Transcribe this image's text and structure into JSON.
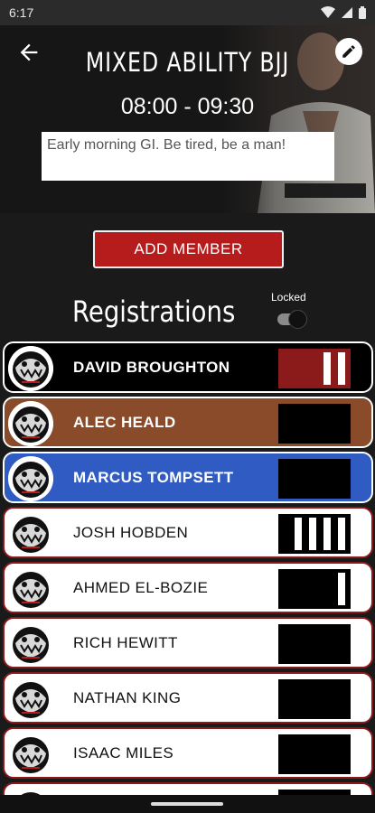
{
  "status": {
    "time": "6:17"
  },
  "header": {
    "title": "MIXED ABILITY BJJ",
    "time": "08:00 - 09:30",
    "description": "Early morning GI. Be tired, be a man!"
  },
  "actions": {
    "add_member": "ADD MEMBER"
  },
  "registrations": {
    "title": "Registrations",
    "locked_label": "Locked",
    "locked": false
  },
  "members": [
    {
      "name": "DAVID  BROUGHTON",
      "row_color": "#000000",
      "name_color": "#ffffff",
      "bold": true,
      "belt": {
        "color": "#8b1a1a",
        "stripes": 2,
        "stripe_color": "#ffffff"
      }
    },
    {
      "name": "ALEC  HEALD",
      "row_color": "#8a4b2a",
      "name_color": "#ffffff",
      "bold": true,
      "belt": {
        "color": "#000000",
        "stripes": 0,
        "stripe_color": "#ffffff"
      }
    },
    {
      "name": "MARCUS  TOMPSETT",
      "row_color": "#2f5bc2",
      "name_color": "#ffffff",
      "bold": true,
      "belt": {
        "color": "#000000",
        "stripes": 0,
        "stripe_color": "#ffffff"
      }
    },
    {
      "name": "JOSH HOBDEN",
      "row_color": "#ffffff",
      "name_color": "#111111",
      "bold": false,
      "belt": {
        "color": "#000000",
        "stripes": 4,
        "stripe_color": "#ffffff"
      }
    },
    {
      "name": "AHMED  EL-BOZIE",
      "row_color": "#ffffff",
      "name_color": "#111111",
      "bold": false,
      "belt": {
        "color": "#000000",
        "stripes": 1,
        "stripe_color": "#ffffff"
      }
    },
    {
      "name": "RICH HEWITT",
      "row_color": "#ffffff",
      "name_color": "#111111",
      "bold": false,
      "belt": {
        "color": "#000000",
        "stripes": 0,
        "stripe_color": "#ffffff"
      }
    },
    {
      "name": "NATHAN KING",
      "row_color": "#ffffff",
      "name_color": "#111111",
      "bold": false,
      "belt": {
        "color": "#000000",
        "stripes": 0,
        "stripe_color": "#ffffff"
      }
    },
    {
      "name": "ISAAC MILES",
      "row_color": "#ffffff",
      "name_color": "#111111",
      "bold": false,
      "belt": {
        "color": "#000000",
        "stripes": 0,
        "stripe_color": "#ffffff"
      }
    },
    {
      "name": "",
      "row_color": "#ffffff",
      "name_color": "#111111",
      "bold": false,
      "belt": {
        "color": "#000000",
        "stripes": 0,
        "stripe_color": "#ffffff"
      }
    }
  ],
  "icons": {
    "back": "arrow-left-icon",
    "edit": "pencil-icon",
    "wifi": "wifi-icon",
    "signal": "signal-icon",
    "battery": "battery-icon"
  }
}
